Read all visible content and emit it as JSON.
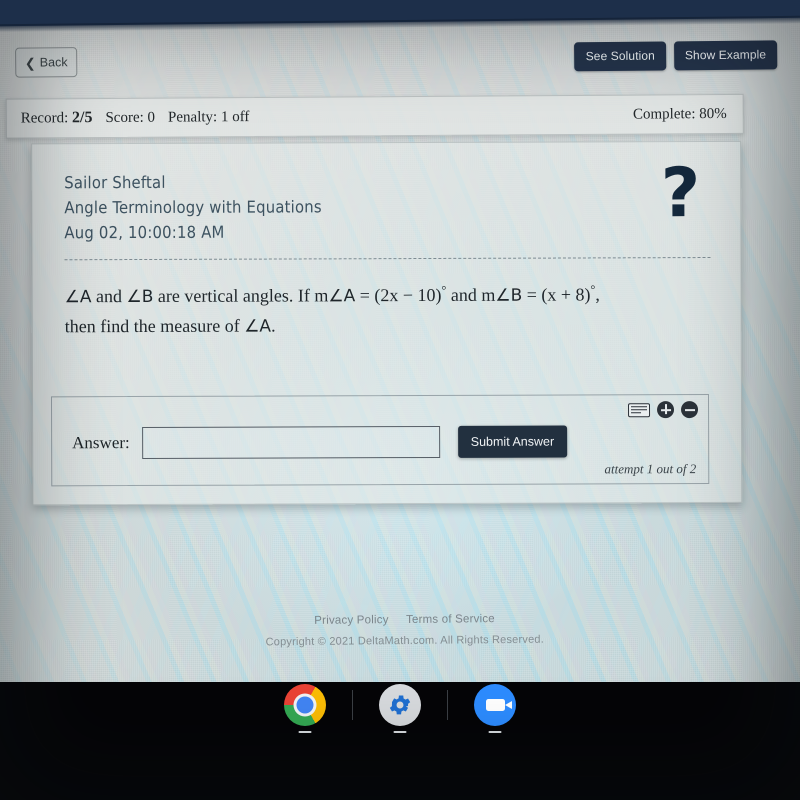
{
  "toolbar": {
    "back_label": "Back",
    "back_icon": "chevron-left-icon",
    "see_solution_label": "See Solution",
    "show_example_label": "Show Example"
  },
  "record_bar": {
    "record_label": "Record:",
    "record_value": "2/5",
    "score_label": "Score:",
    "score_value": "0",
    "penalty_label": "Penalty:",
    "penalty_value": "1 off",
    "complete_text": "Complete: 80%"
  },
  "card": {
    "student_name": "Sailor Sheftal",
    "assignment_title": "Angle Terminology with Equations",
    "timestamp": "Aug 02, 10:00:18 AM",
    "help_icon": "question-mark-icon",
    "problem_line1_a": "∠A",
    "problem_line1_b": " and ",
    "problem_line1_c": "∠B",
    "problem_line1_d": " are vertical angles. If m",
    "problem_line1_e": "∠A",
    "problem_line1_f": " = (2x − 10)",
    "problem_line1_deg": "°",
    "problem_line1_g": " and m",
    "problem_line1_h": "∠B",
    "problem_line1_i": " = (x + 8)",
    "problem_line1_j": ",",
    "problem_line2_a": "then find the measure of ",
    "problem_line2_b": "∠A",
    "problem_line2_c": "."
  },
  "answer": {
    "label": "Answer:",
    "value": "",
    "placeholder": "",
    "submit_label": "Submit Answer",
    "attempt_text": "attempt 1 out of 2",
    "keyboard_icon": "keyboard-icon",
    "zoom_in_icon": "plus-circle-icon",
    "zoom_out_icon": "minus-circle-icon"
  },
  "footer": {
    "privacy_label": "Privacy Policy",
    "terms_label": "Terms of Service",
    "copyright": "Copyright © 2021 DeltaMath.com. All Rights Reserved."
  },
  "shelf": {
    "apps": [
      {
        "name": "chrome-icon",
        "label": "Chrome"
      },
      {
        "name": "settings-gear-icon",
        "label": "Settings"
      },
      {
        "name": "zoom-video-icon",
        "label": "Zoom"
      }
    ]
  },
  "colors": {
    "button_navy": "#24334a",
    "submit_navy": "#22303f",
    "bezel_navy": "#1d2f4a",
    "chrome_blue": "#4285f4",
    "zoom_blue": "#2d8cff"
  }
}
